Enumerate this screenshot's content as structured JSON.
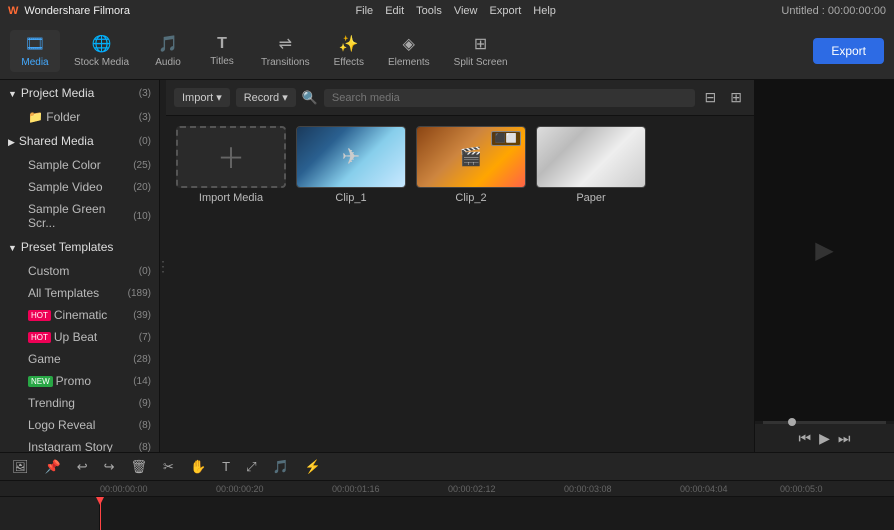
{
  "app": {
    "logo": "W",
    "name": "Wondershare Filmora",
    "title": "Untitled : 00:00:00:00"
  },
  "menu": {
    "items": [
      "File",
      "Edit",
      "Tools",
      "View",
      "Export",
      "Help"
    ]
  },
  "toolbar": {
    "tools": [
      {
        "id": "media",
        "icon": "🎞",
        "label": "Media",
        "active": true
      },
      {
        "id": "stock-media",
        "icon": "🌐",
        "label": "Stock Media",
        "active": false
      },
      {
        "id": "audio",
        "icon": "🎵",
        "label": "Audio",
        "active": false
      },
      {
        "id": "titles",
        "icon": "T",
        "label": "Titles",
        "active": false
      },
      {
        "id": "transitions",
        "icon": "⇌",
        "label": "Transitions",
        "active": false
      },
      {
        "id": "effects",
        "icon": "✨",
        "label": "Effects",
        "active": false
      },
      {
        "id": "elements",
        "icon": "◈",
        "label": "Elements",
        "active": false
      },
      {
        "id": "split-screen",
        "icon": "⊞",
        "label": "Split Screen",
        "active": false
      }
    ],
    "export_label": "Export"
  },
  "content_toolbar": {
    "import_label": "Import",
    "record_label": "Record",
    "search_placeholder": "Search media"
  },
  "sidebar": {
    "sections": [
      {
        "id": "project-media",
        "label": "Project Media",
        "count": 3,
        "expanded": true,
        "children": [
          {
            "id": "folder",
            "label": "Folder",
            "count": 3,
            "indent": true
          }
        ]
      },
      {
        "id": "shared-media",
        "label": "Shared Media",
        "count": 0,
        "expanded": false,
        "children": []
      },
      {
        "id": "sample-color",
        "label": "Sample Color",
        "count": 25,
        "expanded": false,
        "indent": true
      },
      {
        "id": "sample-video",
        "label": "Sample Video",
        "count": 20,
        "expanded": false,
        "indent": true
      },
      {
        "id": "sample-green",
        "label": "Sample Green Scr...",
        "count": 10,
        "expanded": false,
        "indent": true
      },
      {
        "id": "preset-templates",
        "label": "Preset Templates",
        "count": null,
        "expanded": true
      },
      {
        "id": "custom",
        "label": "Custom",
        "count": 0,
        "badge": null,
        "indent": true
      },
      {
        "id": "all-templates",
        "label": "All Templates",
        "count": 189,
        "badge": null,
        "indent": true
      },
      {
        "id": "cinematic",
        "label": "Cinematic",
        "count": 39,
        "badge": "HOT",
        "indent": true
      },
      {
        "id": "up-beat",
        "label": "Up Beat",
        "count": 7,
        "badge": "HOT",
        "indent": true
      },
      {
        "id": "game",
        "label": "Game",
        "count": 28,
        "badge": null,
        "indent": true
      },
      {
        "id": "promo",
        "label": "Promo",
        "count": 14,
        "badge": "NEW",
        "indent": true
      },
      {
        "id": "trending",
        "label": "Trending",
        "count": 9,
        "badge": null,
        "indent": true
      },
      {
        "id": "logo-reveal",
        "label": "Logo Reveal",
        "count": 8,
        "badge": null,
        "indent": true
      },
      {
        "id": "instagram-story",
        "label": "Instagram Story",
        "count": 8,
        "badge": null,
        "indent": true
      }
    ]
  },
  "media_grid": {
    "items": [
      {
        "id": "import-media",
        "label": "Import Media",
        "type": "import"
      },
      {
        "id": "clip1",
        "label": "Clip_1",
        "type": "video",
        "thumb": "clip1"
      },
      {
        "id": "clip2",
        "label": "Clip_2",
        "type": "video",
        "thumb": "clip2",
        "badge": "⬛⬜"
      },
      {
        "id": "paper",
        "label": "Paper",
        "type": "image",
        "thumb": "paper"
      }
    ]
  },
  "timeline": {
    "time_marks": [
      "00:00:00:00",
      "00:00:00:20",
      "00:00:01:16",
      "00:00:02:12",
      "00:00:03:08",
      "00:00:04:04",
      "00:00:05:0"
    ]
  },
  "timeline_toolbar": {
    "buttons": [
      "undo",
      "redo",
      "delete",
      "cut",
      "hand",
      "text",
      "transform",
      "audio",
      "speed"
    ]
  }
}
